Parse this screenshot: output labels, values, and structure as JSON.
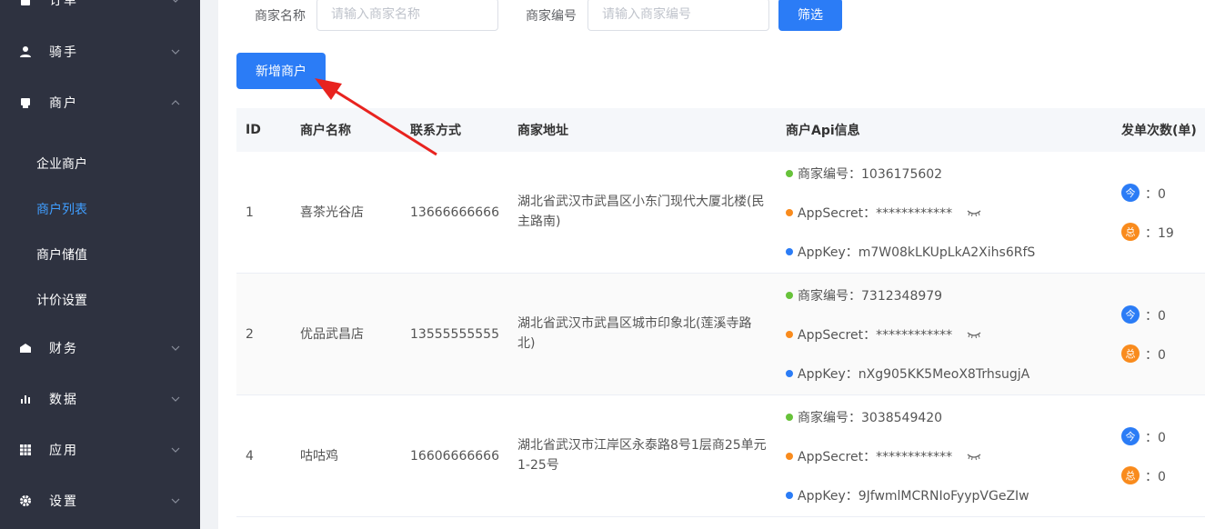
{
  "sidebar": {
    "items": [
      {
        "label": "订单",
        "icon": "order-icon"
      },
      {
        "label": "骑手",
        "icon": "user-icon"
      },
      {
        "label": "商户",
        "icon": "shop-icon"
      },
      {
        "label": "财务",
        "icon": "finance-icon"
      },
      {
        "label": "数据",
        "icon": "bar-chart-icon"
      },
      {
        "label": "应用",
        "icon": "grid-icon"
      },
      {
        "label": "设置",
        "icon": "gear-icon"
      }
    ],
    "sub_items": [
      {
        "label": "企业商户"
      },
      {
        "label": "商户列表",
        "active": true
      },
      {
        "label": "商户储值"
      },
      {
        "label": "计价设置"
      }
    ]
  },
  "filters": {
    "name_label": "商家名称",
    "name_placeholder": "请输入商家名称",
    "code_label": "商家编号",
    "code_placeholder": "请输入商家编号",
    "filter_button": "筛选"
  },
  "add_button": "新增商户",
  "table": {
    "headers": [
      "ID",
      "商户名称",
      "联系方式",
      "商家地址",
      "商户Api信息",
      "发单次数(单)"
    ],
    "rows": [
      {
        "id": "1",
        "name": "喜茶光谷店",
        "phone": "13666666666",
        "address": "湖北省武汉市武昌区小东门现代大厦北楼(民主路南)",
        "code": "商家编号：1036175602",
        "secret": "AppSecret：************",
        "appkey": "AppKey：m7W08kLKUpLkA2Xihs6RfS",
        "today_badge": "今",
        "today": "：0",
        "total_badge": "总",
        "total": "：19"
      },
      {
        "id": "2",
        "name": "优品武昌店",
        "phone": "13555555555",
        "address": "湖北省武汉市武昌区城市印象北(莲溪寺路北)",
        "code": "商家编号：7312348979",
        "secret": "AppSecret：************",
        "appkey": "AppKey：nXg905KK5MeoX8TrhsugjA",
        "today_badge": "今",
        "today": "：0",
        "total_badge": "总",
        "total": "：0"
      },
      {
        "id": "4",
        "name": "咕咕鸡",
        "phone": "16606666666",
        "address": "湖北省武汉市江岸区永泰路8号1层商25单元1-25号",
        "code": "商家编号：3038549420",
        "secret": "AppSecret：************",
        "appkey": "AppKey：9JfwmlMCRNIoFyypVGeZIw",
        "today_badge": "今",
        "today": "：0",
        "total_badge": "总",
        "total": "：0"
      }
    ]
  },
  "colors": {
    "sidebar_bg": "#2e3240",
    "accent": "#2b7cf6",
    "active_text": "#409eff",
    "dot_green": "#67c23a",
    "dot_orange": "#f98b1d",
    "dot_blue": "#2b7cf6",
    "badge_blue": "#2b7cf6",
    "badge_orange": "#f98b1d",
    "annotation_arrow": "#e8231f"
  }
}
